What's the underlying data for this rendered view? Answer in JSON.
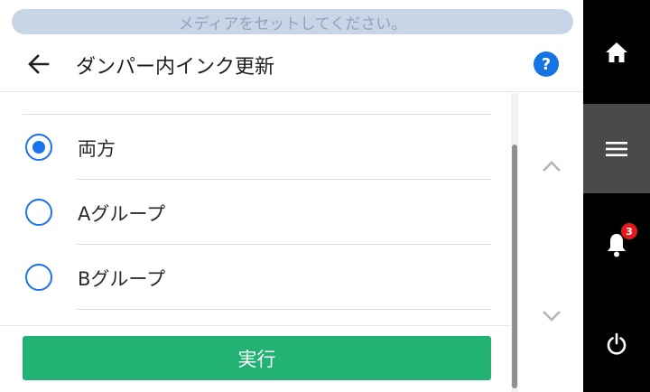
{
  "status": {
    "message": "メディアをセットしてください。"
  },
  "header": {
    "title": "ダンパー内インク更新",
    "back_icon": "arrow-left-icon",
    "help_label": "?"
  },
  "options": [
    {
      "label": "両方",
      "selected": true
    },
    {
      "label": "Aグループ",
      "selected": false
    },
    {
      "label": "Bグループ",
      "selected": false
    }
  ],
  "footer": {
    "execute_label": "実行"
  },
  "nav": {
    "items": [
      {
        "name": "home",
        "icon": "home-icon"
      },
      {
        "name": "menu",
        "icon": "menu-icon",
        "active": true
      },
      {
        "name": "notifications",
        "icon": "bell-icon",
        "badge": "3"
      },
      {
        "name": "power",
        "icon": "power-icon"
      }
    ]
  },
  "colors": {
    "accent": "#1a73e8",
    "execute_button": "#22b273",
    "banner_bg": "#c7d5e6",
    "banner_text": "#8fa2bf",
    "nav_bg": "#000000",
    "nav_active": "#4a4a4a",
    "badge": "#e31b1b"
  }
}
